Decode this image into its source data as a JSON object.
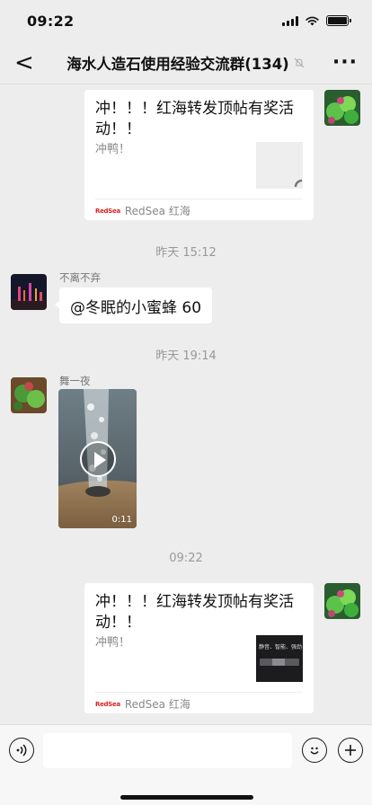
{
  "status": {
    "time": "09:22"
  },
  "header": {
    "back_glyph": "<",
    "title": "海水人造石使用经验交流群(134)",
    "more_glyph": "···"
  },
  "messages": {
    "link1": {
      "title": "冲！！！红海转发顶帖有奖活动！！",
      "desc": "冲鸭！",
      "logo": "RedSea",
      "source": "RedSea 红海"
    },
    "ts1": "昨天 15:12",
    "msg2": {
      "sender": "不离不弃",
      "text": "@冬眠的小蜜蜂 60"
    },
    "ts2": "昨天 19:14",
    "msg3": {
      "sender": "舞一夜",
      "duration": "0:11"
    },
    "ts3": "09:22",
    "link2": {
      "title": "冲！！！红海转发顶帖有奖活动！！",
      "desc": "冲鸭！",
      "thumb_text": "静音、智能、强劲",
      "logo": "RedSea",
      "source": "RedSea 红海"
    }
  },
  "colors": {
    "background": "#ededed",
    "bubble": "#ffffff",
    "meta_text": "#999999",
    "brand_red": "#dd2222"
  },
  "icons": [
    "back-icon",
    "mute-icon",
    "more-icon",
    "play-icon",
    "voice-icon",
    "emoji-icon",
    "add-icon"
  ]
}
